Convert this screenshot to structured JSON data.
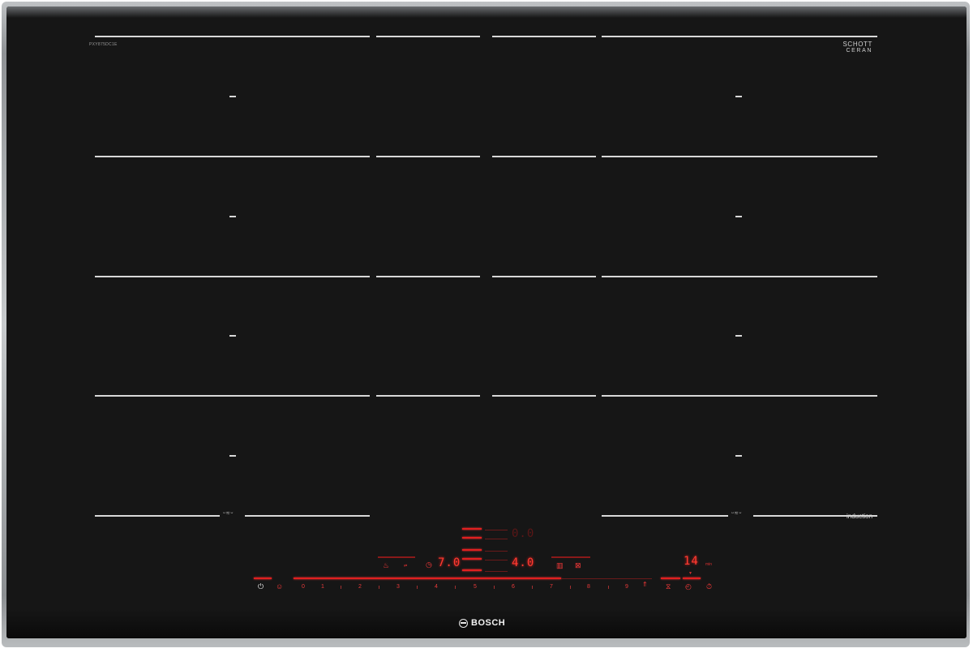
{
  "model_number": "PXY875DC1E",
  "glass_brand": {
    "line1": "SCHOTT",
    "line2": "CERAN",
    "line3": ""
  },
  "bridge_icon": "bridge-icon",
  "induction_label": "induction",
  "brand": {
    "name": "BOSCH",
    "logo_icon": "bosch-logo-icon"
  },
  "controls": {
    "displays": {
      "top_value": "0.0",
      "left_value": "7.0",
      "mid_value": "4.0",
      "right_value": "14",
      "right_unit": "min"
    },
    "slider_numbers": [
      "0",
      "1",
      "2",
      "3",
      "4",
      "5",
      "6",
      "7",
      "8",
      "9"
    ],
    "icons": {
      "power": "power-icon",
      "child_lock": "child-lock-icon",
      "keep_warm": "pot-icon",
      "move": "move-icon",
      "timer_left": "timer-icon",
      "frying_sensor": "frying-sensor-icon",
      "roasting": "roasting-icon",
      "boost": "boost-icon",
      "powermove": "powermove-icon",
      "timer_right": "clock-icon",
      "stopwatch": "stopwatch-icon"
    },
    "colors": {
      "display": "#ff3b30",
      "dim": "#5a1616"
    }
  },
  "colors": {
    "glass": "#161616",
    "frame": "#a0a3a6",
    "lines": "#d8d8d8"
  }
}
